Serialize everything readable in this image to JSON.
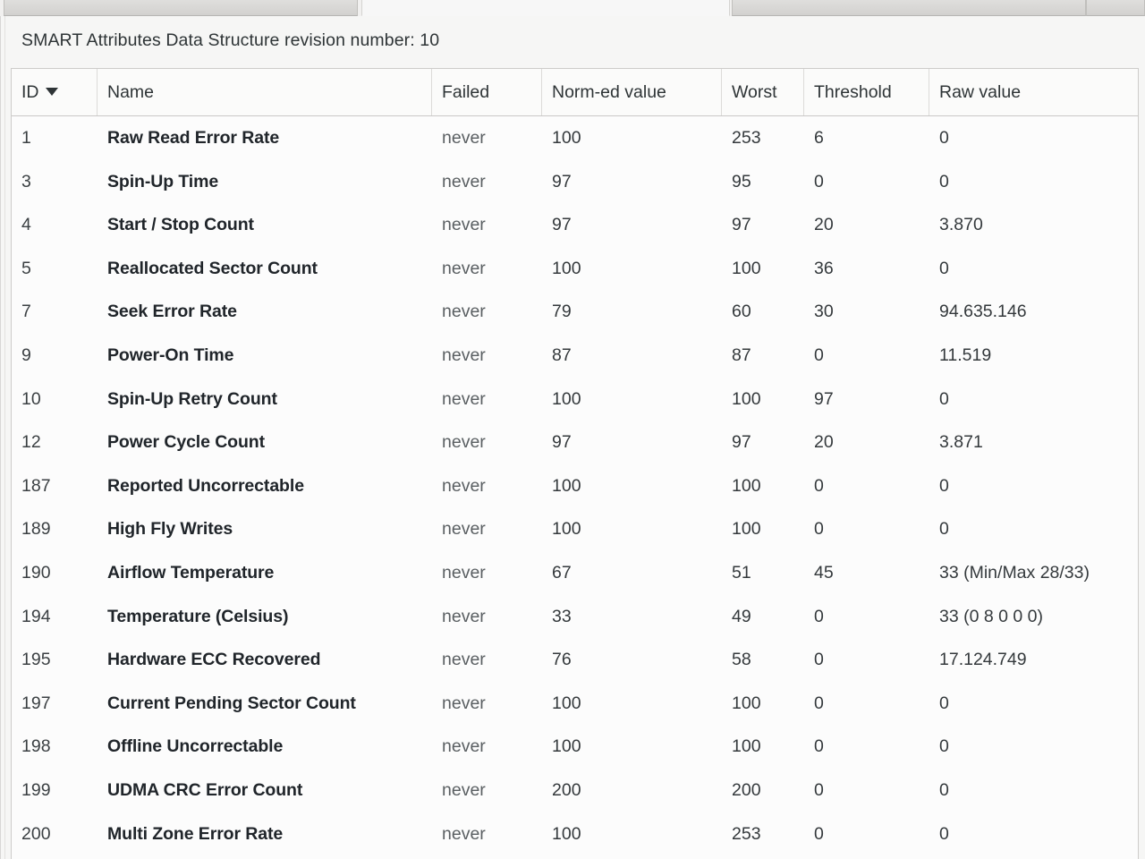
{
  "window": {
    "tabs": [
      {
        "label": "",
        "active": false
      },
      {
        "label": "",
        "active": true
      },
      {
        "label": "",
        "active": false
      },
      {
        "label": "",
        "active": false
      }
    ]
  },
  "info": {
    "revision_text": "SMART Attributes Data Structure revision number: 10"
  },
  "table": {
    "sort_column": "ID",
    "sort_direction": "descending",
    "sort_icon": "chevron-down-icon",
    "columns": [
      {
        "key": "id",
        "label": "ID"
      },
      {
        "key": "name",
        "label": "Name"
      },
      {
        "key": "failed",
        "label": "Failed"
      },
      {
        "key": "normed",
        "label": "Norm-ed value"
      },
      {
        "key": "worst",
        "label": "Worst"
      },
      {
        "key": "threshold",
        "label": "Threshold"
      },
      {
        "key": "raw",
        "label": "Raw value"
      }
    ],
    "rows": [
      {
        "id": "1",
        "name": "Raw Read Error Rate",
        "failed": "never",
        "normed": "100",
        "worst": "253",
        "threshold": "6",
        "raw": "0"
      },
      {
        "id": "3",
        "name": "Spin-Up Time",
        "failed": "never",
        "normed": "97",
        "worst": "95",
        "threshold": "0",
        "raw": "0"
      },
      {
        "id": "4",
        "name": "Start / Stop Count",
        "failed": "never",
        "normed": "97",
        "worst": "97",
        "threshold": "20",
        "raw": "3.870"
      },
      {
        "id": "5",
        "name": "Reallocated Sector Count",
        "failed": "never",
        "normed": "100",
        "worst": "100",
        "threshold": "36",
        "raw": "0"
      },
      {
        "id": "7",
        "name": "Seek Error Rate",
        "failed": "never",
        "normed": "79",
        "worst": "60",
        "threshold": "30",
        "raw": "94.635.146"
      },
      {
        "id": "9",
        "name": "Power-On Time",
        "failed": "never",
        "normed": "87",
        "worst": "87",
        "threshold": "0",
        "raw": "11.519"
      },
      {
        "id": "10",
        "name": "Spin-Up Retry Count",
        "failed": "never",
        "normed": "100",
        "worst": "100",
        "threshold": "97",
        "raw": "0"
      },
      {
        "id": "12",
        "name": "Power Cycle Count",
        "failed": "never",
        "normed": "97",
        "worst": "97",
        "threshold": "20",
        "raw": "3.871"
      },
      {
        "id": "187",
        "name": "Reported Uncorrectable",
        "failed": "never",
        "normed": "100",
        "worst": "100",
        "threshold": "0",
        "raw": "0"
      },
      {
        "id": "189",
        "name": "High Fly Writes",
        "failed": "never",
        "normed": "100",
        "worst": "100",
        "threshold": "0",
        "raw": "0"
      },
      {
        "id": "190",
        "name": "Airflow Temperature",
        "failed": "never",
        "normed": "67",
        "worst": "51",
        "threshold": "45",
        "raw": "33 (Min/Max 28/33)"
      },
      {
        "id": "194",
        "name": "Temperature (Celsius)",
        "failed": "never",
        "normed": "33",
        "worst": "49",
        "threshold": "0",
        "raw": "33 (0 8 0 0 0)"
      },
      {
        "id": "195",
        "name": "Hardware ECC Recovered",
        "failed": "never",
        "normed": "76",
        "worst": "58",
        "threshold": "0",
        "raw": "17.124.749"
      },
      {
        "id": "197",
        "name": "Current Pending Sector Count",
        "failed": "never",
        "normed": "100",
        "worst": "100",
        "threshold": "0",
        "raw": "0"
      },
      {
        "id": "198",
        "name": "Offline Uncorrectable",
        "failed": "never",
        "normed": "100",
        "worst": "100",
        "threshold": "0",
        "raw": "0"
      },
      {
        "id": "199",
        "name": "UDMA CRC Error Count",
        "failed": "never",
        "normed": "200",
        "worst": "200",
        "threshold": "0",
        "raw": "0"
      },
      {
        "id": "200",
        "name": "Multi Zone Error Rate",
        "failed": "never",
        "normed": "100",
        "worst": "253",
        "threshold": "0",
        "raw": "0"
      }
    ]
  },
  "colors": {
    "text": "#2e3436",
    "muted": "#5a5f62",
    "row_bg": "#fcfcfc",
    "header_bg": "#fbfbfa",
    "border": "#cdccca",
    "window_bg": "#f6f6f5"
  }
}
